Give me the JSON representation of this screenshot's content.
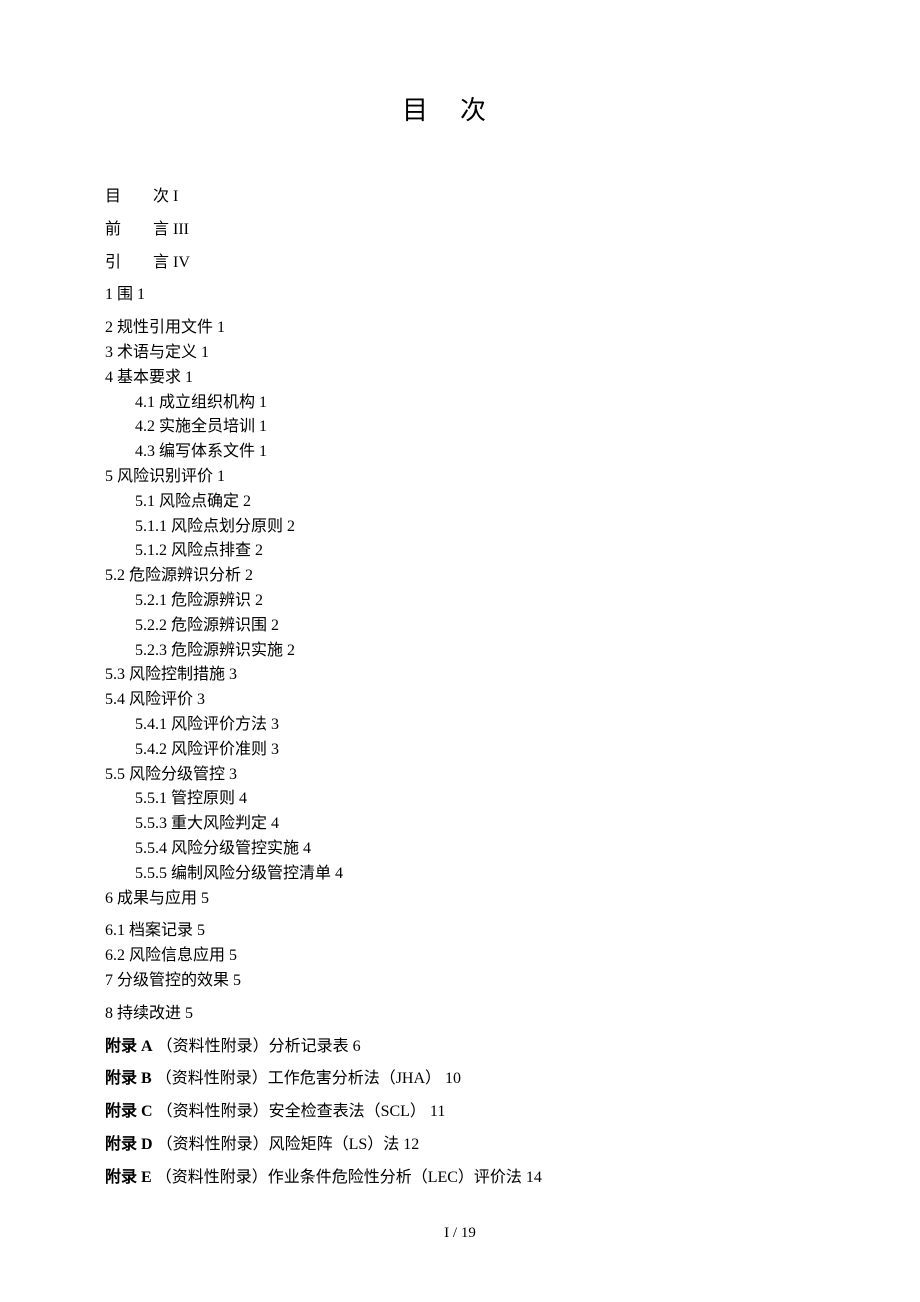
{
  "title": "目次",
  "footer": "I / 19",
  "entries": [
    {
      "num": "",
      "label": "目　　次",
      "page": "I",
      "indent": 0,
      "spaced": false,
      "bold": false,
      "spacer_after": true
    },
    {
      "num": "",
      "label": "前　　言",
      "page": "III",
      "indent": 0,
      "spaced": false,
      "bold": false,
      "spacer_after": true
    },
    {
      "num": "",
      "label": "引　　言",
      "page": "IV",
      "indent": 0,
      "spaced": false,
      "bold": false,
      "spacer_after": true
    },
    {
      "num": "1",
      "label": "围",
      "page": "1",
      "indent": 0,
      "spaced": false,
      "bold": false,
      "spacer_after": true
    },
    {
      "num": "2",
      "label": "规性引用文件",
      "page": "1",
      "indent": 0,
      "spaced": false,
      "bold": false,
      "spacer_after": false
    },
    {
      "num": "3",
      "label": "术语与定义",
      "page": "1",
      "indent": 0,
      "spaced": false,
      "bold": false,
      "spacer_after": false
    },
    {
      "num": "4",
      "label": "基本要求",
      "page": "1",
      "indent": 0,
      "spaced": false,
      "bold": false,
      "spacer_after": false
    },
    {
      "num": "4.1",
      "label": "成立组织机构",
      "page": "1",
      "indent": 1,
      "spaced": false,
      "bold": false,
      "spacer_after": false
    },
    {
      "num": "4.2",
      "label": "实施全员培训",
      "page": "1",
      "indent": 1,
      "spaced": false,
      "bold": false,
      "spacer_after": false
    },
    {
      "num": "4.3",
      "label": "编写体系文件",
      "page": "1",
      "indent": 1,
      "spaced": false,
      "bold": false,
      "spacer_after": false
    },
    {
      "num": "5",
      "label": "风险识别评价",
      "page": "1",
      "indent": 0,
      "spaced": false,
      "bold": false,
      "spacer_after": false
    },
    {
      "num": "5.1",
      "label": "风险点确定",
      "page": "2",
      "indent": 1,
      "spaced": false,
      "bold": false,
      "spacer_after": false
    },
    {
      "num": "5.1.1",
      "label": "风险点划分原则",
      "page": "2",
      "indent": 2,
      "spaced": false,
      "bold": false,
      "spacer_after": false
    },
    {
      "num": "5.1.2",
      "label": "风险点排查",
      "page": "2",
      "indent": 2,
      "spaced": false,
      "bold": false,
      "spacer_after": false
    },
    {
      "num": "5.2",
      "label": "危险源辨识分析",
      "page": "2",
      "indent": 0,
      "spaced": false,
      "bold": false,
      "spacer_after": false
    },
    {
      "num": "5.2.1",
      "label": "危险源辨识",
      "page": "2",
      "indent": 2,
      "spaced": false,
      "bold": false,
      "spacer_after": false
    },
    {
      "num": "5.2.2",
      "label": "危险源辨识围",
      "page": "2",
      "indent": 2,
      "spaced": false,
      "bold": false,
      "spacer_after": false
    },
    {
      "num": "5.2.3",
      "label": "危险源辨识实施",
      "page": "2",
      "indent": 2,
      "spaced": false,
      "bold": false,
      "spacer_after": false
    },
    {
      "num": "5.3",
      "label": "风险控制措施",
      "page": "3",
      "indent": 0,
      "spaced": false,
      "bold": false,
      "spacer_after": false
    },
    {
      "num": "5.4",
      "label": "风险评价",
      "page": "3",
      "indent": 0,
      "spaced": false,
      "bold": false,
      "spacer_after": false
    },
    {
      "num": "5.4.1",
      "label": "风险评价方法",
      "page": "3",
      "indent": 2,
      "spaced": false,
      "bold": false,
      "spacer_after": false
    },
    {
      "num": "5.4.2",
      "label": "风险评价准则",
      "page": "3",
      "indent": 2,
      "spaced": false,
      "bold": false,
      "spacer_after": false
    },
    {
      "num": "5.5",
      "label": "风险分级管控",
      "page": "3",
      "indent": 0,
      "spaced": false,
      "bold": false,
      "spacer_after": false
    },
    {
      "num": "5.5.1",
      "label": "管控原则",
      "page": "4",
      "indent": 2,
      "spaced": false,
      "bold": false,
      "spacer_after": false
    },
    {
      "num": "5.5.3",
      "label": "重大风险判定",
      "page": "4",
      "indent": 2,
      "spaced": false,
      "bold": false,
      "spacer_after": false
    },
    {
      "num": "5.5.4",
      "label": "风险分级管控实施",
      "page": "4",
      "indent": 2,
      "spaced": false,
      "bold": false,
      "spacer_after": false
    },
    {
      "num": "5.5.5",
      "label": "编制风险分级管控清单",
      "page": "4",
      "indent": 2,
      "spaced": false,
      "bold": false,
      "spacer_after": false
    },
    {
      "num": "6",
      "label": "成果与应用",
      "page": "5",
      "indent": 0,
      "spaced": false,
      "bold": false,
      "spacer_after": true
    },
    {
      "num": "6.1",
      "label": "档案记录",
      "page": "5",
      "indent": 0,
      "spaced": false,
      "bold": false,
      "spacer_after": false
    },
    {
      "num": "6.2",
      "label": "风险信息应用",
      "page": "5",
      "indent": 0,
      "spaced": false,
      "bold": false,
      "spacer_after": false
    },
    {
      "num": "7",
      "label": "分级管控的效果",
      "page": "5",
      "indent": 0,
      "spaced": false,
      "bold": false,
      "spacer_after": true
    },
    {
      "num": "8",
      "label": "持续改进",
      "page": "5",
      "indent": 0,
      "spaced": false,
      "bold": false,
      "spacer_after": true
    },
    {
      "num": "附录 A",
      "label": "（资料性附录）分析记录表",
      "page": "6",
      "indent": 0,
      "spaced": false,
      "bold": true,
      "label_bold_split": true,
      "spacer_after": true
    },
    {
      "num": "附录 B",
      "label": "（资料性附录）工作危害分析法（JHA）",
      "page": "10",
      "indent": 0,
      "spaced": false,
      "bold": true,
      "label_bold_split": true,
      "spacer_after": true
    },
    {
      "num": "附录 C",
      "label": "（资料性附录）安全检查表法（SCL）",
      "page": "11",
      "indent": 0,
      "spaced": false,
      "bold": true,
      "label_bold_split": true,
      "spacer_after": true
    },
    {
      "num": "附录 D",
      "label": "（资料性附录）风险矩阵（LS）法",
      "page": "12",
      "indent": 0,
      "spaced": false,
      "bold": true,
      "label_bold_split": true,
      "spacer_after": true
    },
    {
      "num": "附录 E",
      "label": "（资料性附录）作业条件危险性分析（LEC）评价法",
      "page": "14",
      "indent": 0,
      "spaced": false,
      "bold": true,
      "label_bold_split": true,
      "spacer_after": false
    }
  ]
}
